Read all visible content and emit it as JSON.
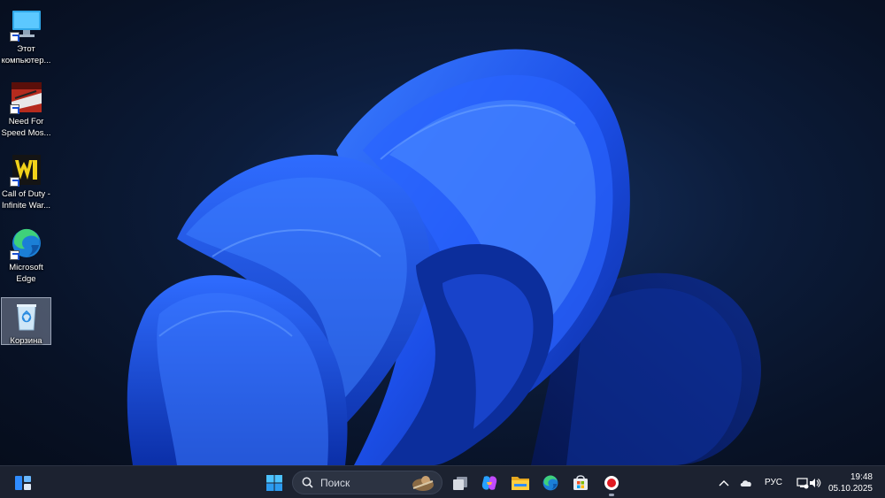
{
  "desktop": {
    "icons": [
      {
        "label": "Этот\nкомпьютер...",
        "icon": "computer-icon",
        "shortcut": true
      },
      {
        "label": "Need For\nSpeed Mos...",
        "icon": "nfs-game-icon",
        "shortcut": true
      },
      {
        "label": "Call of Duty -\nInfinite War...",
        "icon": "cod-game-icon",
        "shortcut": true
      },
      {
        "label": "Microsoft\nEdge",
        "icon": "edge-icon",
        "shortcut": true
      },
      {
        "label": "Корзина",
        "icon": "recycle-bin-icon",
        "shortcut": false,
        "selected": true
      }
    ]
  },
  "taskbar": {
    "search_placeholder": "Поиск",
    "apps": [
      "start-icon",
      "task-view-icon",
      "copilot-icon",
      "file-explorer-icon",
      "edge-icon",
      "store-icon",
      "recorder-icon"
    ],
    "tray": {
      "language": "РУС",
      "time": "19:48",
      "date": "05.10.2025"
    }
  },
  "colors": {
    "taskbar_bg": "#1c2230",
    "wallpaper_accent": "#1f5af0"
  }
}
